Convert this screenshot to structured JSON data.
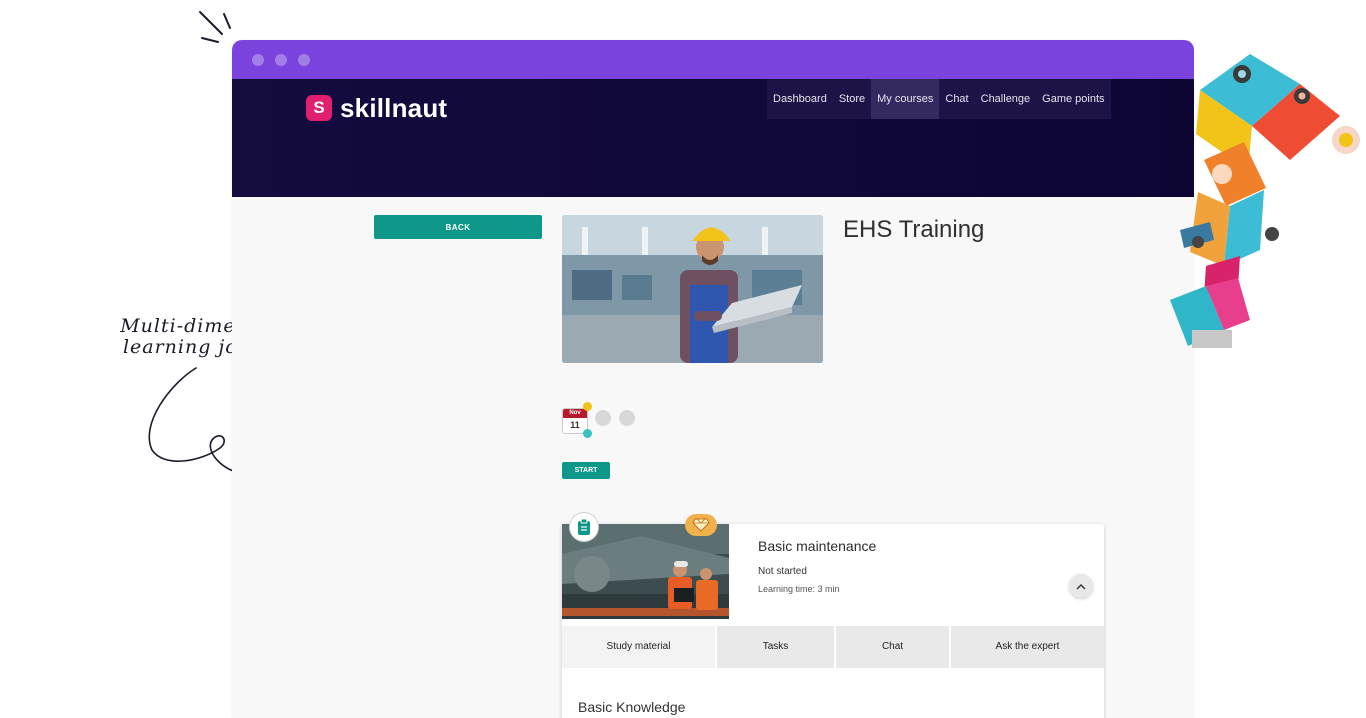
{
  "annotation": {
    "line1": "Multi-dimensional",
    "line2": "learning journeys"
  },
  "brand": {
    "logo_letter": "S",
    "name": "skillnaut"
  },
  "nav": {
    "items": [
      {
        "label": "Dashboard"
      },
      {
        "label": "Store"
      },
      {
        "label": "My courses",
        "active": true
      },
      {
        "label": "Chat"
      },
      {
        "label": "Challenge"
      },
      {
        "label": "Game points"
      }
    ]
  },
  "course": {
    "back_label": "BACK",
    "title": "EHS Training",
    "calendar": {
      "month": "Nov",
      "day": "11"
    },
    "start_label": "START"
  },
  "module": {
    "title": "Basic maintenance",
    "status": "Not started",
    "learning_time": "Learning time: 3 min",
    "tabs": [
      {
        "label": "Study material",
        "active": true
      },
      {
        "label": "Tasks"
      },
      {
        "label": "Chat"
      },
      {
        "label": "Ask the expert"
      }
    ],
    "section_title": "Basic Knowledge"
  },
  "colors": {
    "titlebar": "#7b43dd",
    "hero": "#140b3e",
    "accent": "#0f988a",
    "brand_pink": "#e0206e",
    "gem": "#f2b24b"
  },
  "icons": [
    "clipboard-icon",
    "gem-icon",
    "chevron-up-icon",
    "calendar-icon"
  ]
}
